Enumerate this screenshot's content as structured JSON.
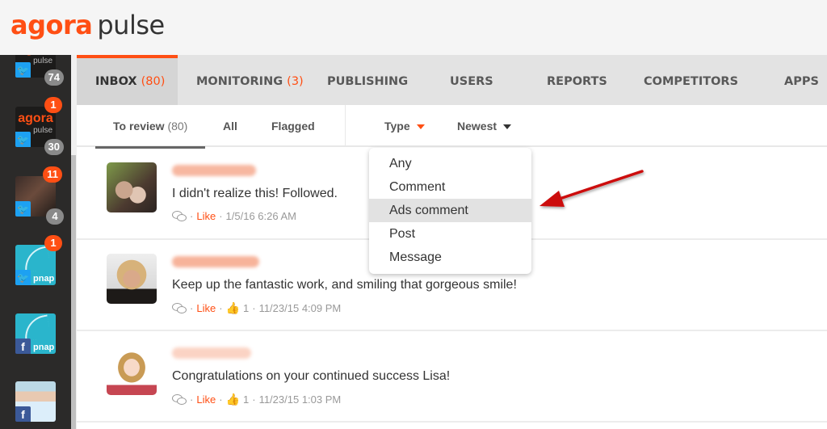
{
  "brand": {
    "name_primary": "agora",
    "name_secondary": "pulse",
    "accent": "#ff4f14"
  },
  "sidebar": {
    "accounts": [
      {
        "name": "agorapulse-twitter",
        "network": "twitter",
        "logo_text": "agora",
        "logo_sub": "pulse",
        "badge_bottom": "74"
      },
      {
        "name": "agorapulse-twitter-2",
        "network": "twitter",
        "logo_text": "agora",
        "logo_sub": "pulse",
        "badge_top": "1",
        "badge_bottom": "30"
      },
      {
        "name": "personal-twitter",
        "network": "twitter",
        "badge_top": "11",
        "badge_bottom": "4"
      },
      {
        "name": "pnap-twitter",
        "network": "twitter",
        "logo_text": "pnap",
        "badge_top": "1"
      },
      {
        "name": "pnap-facebook",
        "network": "facebook",
        "logo_text": "pnap"
      },
      {
        "name": "medical-facebook",
        "network": "facebook"
      }
    ],
    "twitter_glyph": "🐦",
    "facebook_glyph": "f"
  },
  "nav": {
    "tabs": [
      {
        "label": "INBOX",
        "count": "(80)",
        "active": true
      },
      {
        "label": "MONITORING",
        "count": "(3)"
      },
      {
        "label": "PUBLISHING"
      },
      {
        "label": "USERS"
      },
      {
        "label": "REPORTS"
      },
      {
        "label": "COMPETITORS"
      },
      {
        "label": "APPS"
      }
    ]
  },
  "subnav": {
    "to_review_label": "To review",
    "to_review_count": "(80)",
    "all_label": "All",
    "flagged_label": "Flagged",
    "type_label": "Type",
    "sort_label": "Newest"
  },
  "type_dropdown": {
    "options": [
      "Any",
      "Comment",
      "Ads comment",
      "Post",
      "Message"
    ],
    "highlighted": "Ads comment"
  },
  "inbox_items": [
    {
      "message": "I didn't realize this! Followed.",
      "like_label": "Like",
      "likes": "",
      "timestamp": "1/5/16 6:26 AM"
    },
    {
      "message": "Keep up the fantastic work, and smiling that gorgeous smile!",
      "like_label": "Like",
      "likes": "1",
      "timestamp": "11/23/15 4:09 PM"
    },
    {
      "message": "Congratulations on your continued success Lisa!",
      "like_label": "Like",
      "likes": "1",
      "timestamp": "11/23/15 1:03 PM"
    }
  ],
  "meta_separator": "·",
  "annotation": {
    "type": "arrow",
    "color": "#cc1111",
    "points_to": "Ads comment"
  }
}
